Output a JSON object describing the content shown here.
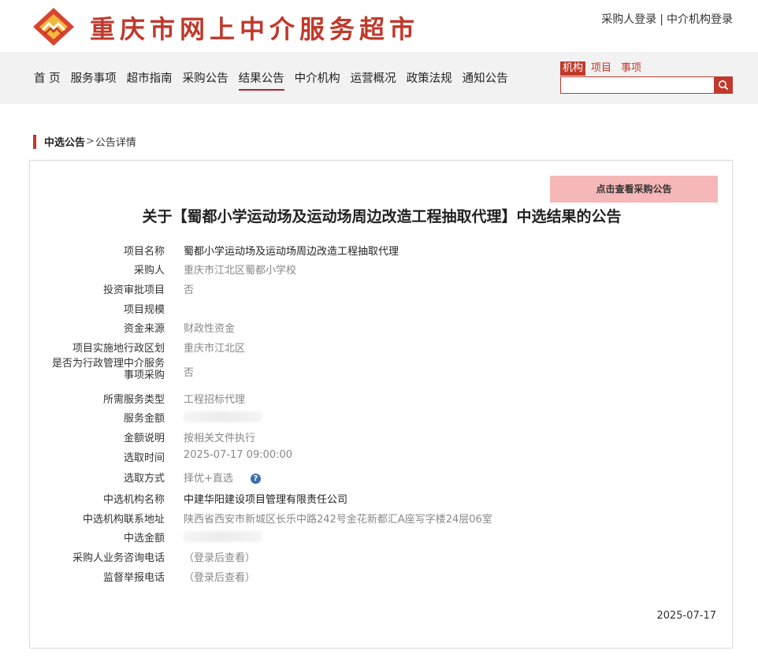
{
  "header": {
    "site_title": "重庆市网上中介服务超市",
    "buyer_login": "采购人登录",
    "separator": "|",
    "agency_login": "中介机构登录",
    "brand_color": "#c0392b"
  },
  "nav": {
    "items": [
      {
        "label": "首 页"
      },
      {
        "label": "服务事项"
      },
      {
        "label": "超市指南"
      },
      {
        "label": "采购公告"
      },
      {
        "label": "结果公告"
      },
      {
        "label": "中介机构"
      },
      {
        "label": "运营概况"
      },
      {
        "label": "政策法规"
      },
      {
        "label": "通知公告"
      }
    ],
    "active": "结果公告"
  },
  "search": {
    "tabs": [
      "机构",
      "项目",
      "事项"
    ],
    "active_tab": "机构",
    "value": "",
    "icon": "search-icon"
  },
  "breadcrumb": {
    "section": "中选公告",
    "separator": ">",
    "current": "公告详情"
  },
  "notice": {
    "view_purchase_button": "点击查看采购公告",
    "title": "关于【蜀都小学运动场及运动场周边改造工程抽取代理】中选结果的公告",
    "date": "2025-07-17",
    "fields": [
      {
        "label": "项目名称",
        "value": "蜀都小学运动场及运动场周边改造工程抽取代理"
      },
      {
        "label": "采购人",
        "value": "重庆市江北区蜀都小学校"
      },
      {
        "label": "投资审批项目",
        "value": "否"
      },
      {
        "label": "项目规模",
        "value": ""
      },
      {
        "label": "资金来源",
        "value": "财政性资金"
      },
      {
        "label": "项目实施地行政区划",
        "value": "重庆市江北区"
      },
      {
        "label_line1": "是否为行政管理中介服务",
        "label_line2": "事项采购",
        "value": "否"
      },
      {
        "label": "所需服务类型",
        "value": "工程招标代理"
      },
      {
        "label": "服务金额",
        "value": ""
      },
      {
        "label": "金额说明",
        "value": "按相关文件执行"
      },
      {
        "label": "选取时间",
        "value": "2025-07-17 09:00:00"
      },
      {
        "label": "选取方式",
        "value": "择优+直选",
        "help_icon": "help-icon"
      },
      {
        "label": "中选机构名称",
        "value": "中建华阳建设项目管理有限责任公司"
      },
      {
        "label": "中选机构联系地址",
        "value": "陕西省西安市新城区长乐中路242号金花新都汇A座写字楼24层06室"
      },
      {
        "label": "中选金额",
        "value": ""
      },
      {
        "label": "采购人业务咨询电话",
        "value": "（登录后查看）"
      },
      {
        "label": "监督举报电话",
        "value": "（登录后查看）"
      }
    ]
  }
}
